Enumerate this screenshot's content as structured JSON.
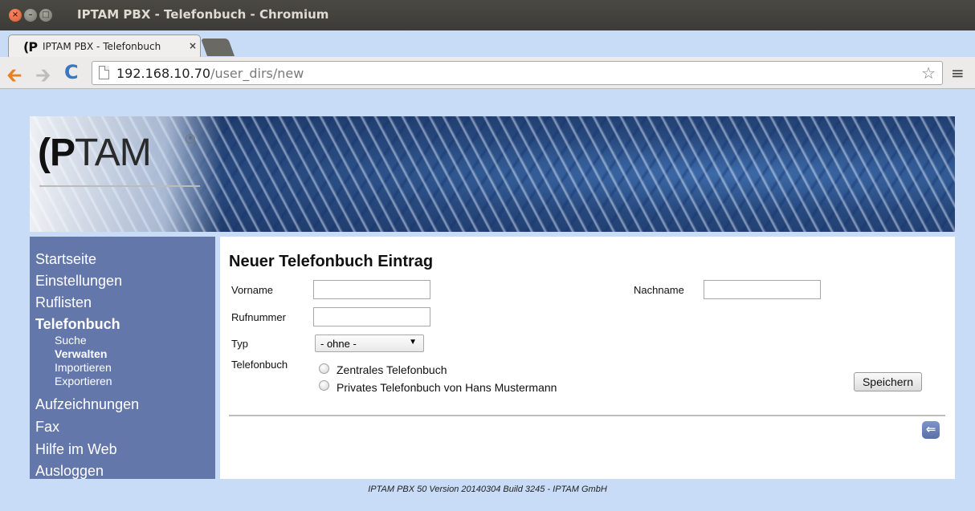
{
  "window": {
    "title": "IPTAM PBX - Telefonbuch - Chromium",
    "close_glyph": "×",
    "min_glyph": "–",
    "max_glyph": "□"
  },
  "tab": {
    "favicon": "(P",
    "title": "IPTAM PBX - Telefonbuch",
    "close_glyph": "×"
  },
  "toolbar": {
    "back_glyph": "🡰",
    "forward_glyph": "🡲",
    "reload_glyph": "C",
    "url_host": "192.168.10.70",
    "url_path": "/user_dirs/new",
    "star_glyph": "☆",
    "menu_glyph": "≡"
  },
  "banner": {
    "logo_ip": "(P",
    "logo_rest": "TAM",
    "logo_mark": "®"
  },
  "sidebar": {
    "items": [
      {
        "label": "Startseite"
      },
      {
        "label": "Einstellungen"
      },
      {
        "label": "Ruflisten"
      },
      {
        "label": "Telefonbuch",
        "active": true
      },
      {
        "label": "Aufzeichnungen"
      },
      {
        "label": "Fax"
      },
      {
        "label": "Hilfe im Web"
      },
      {
        "label": "Ausloggen"
      }
    ],
    "subitems": [
      {
        "label": "Suche"
      },
      {
        "label": "Verwalten",
        "active": true
      },
      {
        "label": "Importieren"
      },
      {
        "label": "Exportieren"
      }
    ]
  },
  "main": {
    "title": "Neuer Telefonbuch Eintrag",
    "fields": {
      "vorname_label": "Vorname",
      "vorname_value": "",
      "nachname_label": "Nachname",
      "nachname_value": "",
      "rufnummer_label": "Rufnummer",
      "rufnummer_value": "",
      "typ_label": "Typ",
      "typ_value": "- ohne -",
      "typ_arrow": "▼",
      "telefonbuch_label": "Telefonbuch",
      "telefonbuch_options": [
        "Zentrales Telefonbuch",
        "Privates Telefonbuch von Hans Mustermann"
      ]
    },
    "save_label": "Speichern",
    "back_glyph": "⇐"
  },
  "footer": {
    "text": "IPTAM PBX 50 Version 20140304 Build 3245 - IPTAM GmbH"
  }
}
